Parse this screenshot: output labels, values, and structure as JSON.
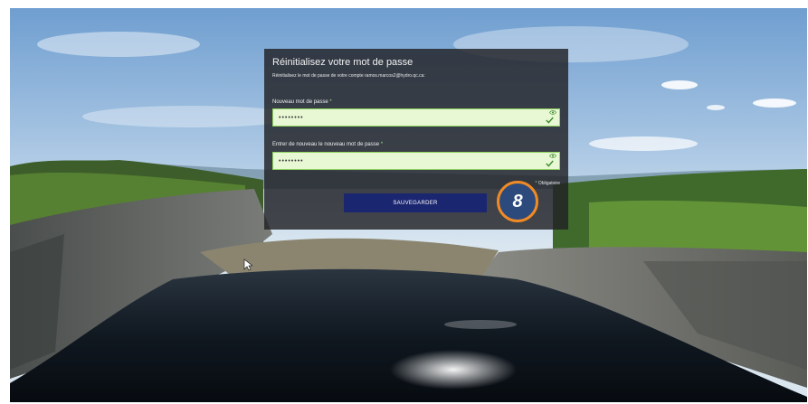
{
  "dialog": {
    "title": "Réinitialisez votre mot de passe",
    "subtitle": "Réinitialisez le mot de passe de votre compte ramos.marcos2@hydro.qc.ca:",
    "new_password": {
      "label": "Nouveau mot de passe",
      "required_marker": "*",
      "value": "••••••••"
    },
    "confirm_password": {
      "label": "Entrer de nouveau le nouveau mot de passe",
      "required_marker": "*",
      "value": "••••••••"
    },
    "required_note": {
      "marker": "*",
      "text": "Obligatoire"
    },
    "save_label": "SAUVEGARDER"
  },
  "step_badge": "8",
  "icons": {
    "show_password": "eye-icon",
    "valid": "checkmark-icon",
    "pointer": "mouse-cursor-icon"
  },
  "colors": {
    "field_valid_bg": "#e8f8d4",
    "field_valid_border": "#8fd35e",
    "save_button": "#1b2670",
    "badge_fill": "#2c4a7c",
    "badge_ring": "#f08a24",
    "dialog_overlay": "rgba(33,33,36,0.82)"
  }
}
